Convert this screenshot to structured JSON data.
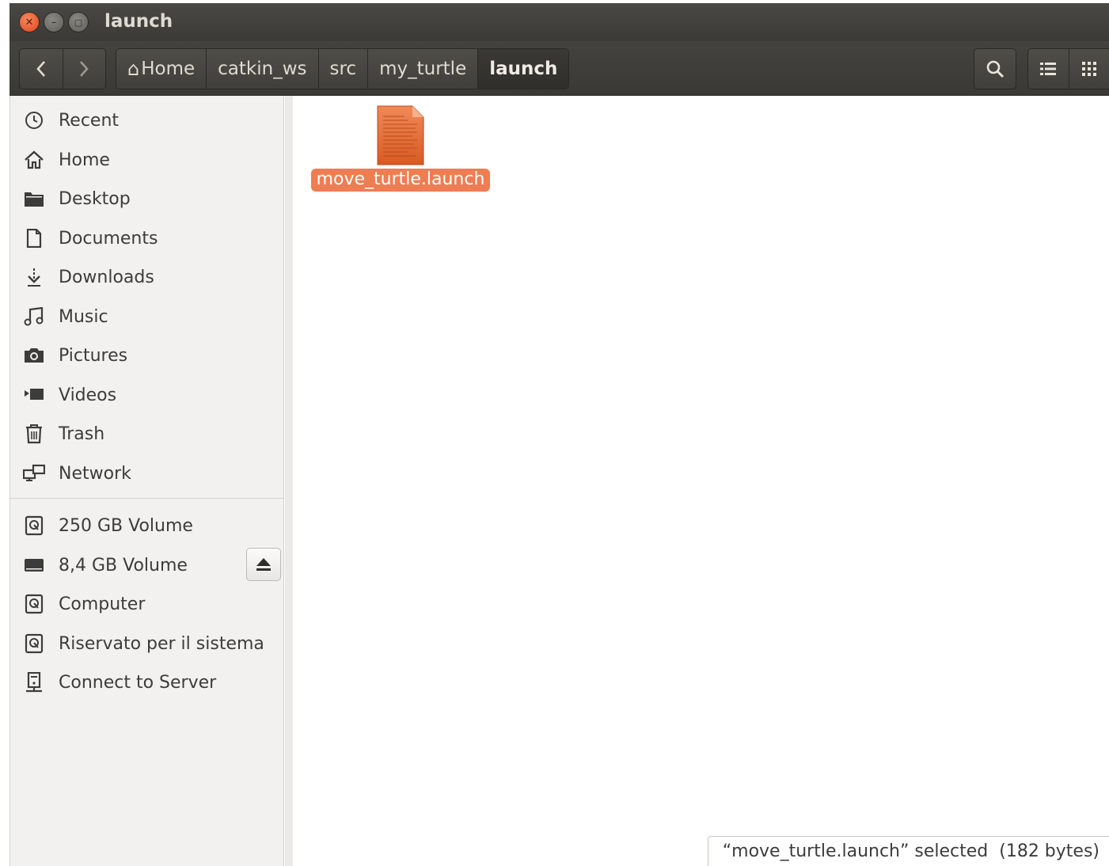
{
  "window": {
    "title": "launch"
  },
  "toolbar": {
    "back_icon": "chevron-left-icon",
    "forward_icon": "chevron-right-icon",
    "breadcrumbs": [
      {
        "label": "Home",
        "icon": "home-icon"
      },
      {
        "label": "catkin_ws"
      },
      {
        "label": "src"
      },
      {
        "label": "my_turtle"
      },
      {
        "label": "launch",
        "active": true
      }
    ],
    "search_icon": "search-icon",
    "list_view_icon": "list-view-icon",
    "grid_view_icon": "grid-view-icon"
  },
  "sidebar": {
    "places": [
      {
        "label": "Recent",
        "icon": "clock-icon"
      },
      {
        "label": "Home",
        "icon": "home-icon"
      },
      {
        "label": "Desktop",
        "icon": "folder-icon"
      },
      {
        "label": "Documents",
        "icon": "document-icon"
      },
      {
        "label": "Downloads",
        "icon": "download-icon"
      },
      {
        "label": "Music",
        "icon": "music-icon"
      },
      {
        "label": "Pictures",
        "icon": "camera-icon"
      },
      {
        "label": "Videos",
        "icon": "video-icon"
      },
      {
        "label": "Trash",
        "icon": "trash-icon"
      },
      {
        "label": "Network",
        "icon": "network-icon"
      }
    ],
    "devices": [
      {
        "label": "250 GB Volume",
        "icon": "drive-icon"
      },
      {
        "label": "8,4 GB Volume",
        "icon": "removable-drive-icon",
        "ejectable": true
      },
      {
        "label": "Computer",
        "icon": "drive-icon"
      },
      {
        "label": "Riservato per il sistema",
        "icon": "drive-icon"
      },
      {
        "label": "Connect to Server",
        "icon": "server-icon"
      }
    ]
  },
  "content": {
    "files": [
      {
        "name": "move_turtle.launch",
        "selected": true,
        "icon": "text-file-icon"
      }
    ]
  },
  "status": {
    "text": "“move_turtle.launch” selected  (182 bytes)"
  },
  "colors": {
    "selection": "#ef7d53",
    "close_button": "#e0441d",
    "header": "#3b3a36"
  }
}
